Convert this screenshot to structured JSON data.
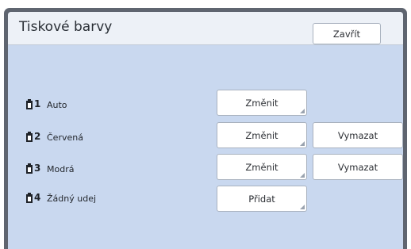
{
  "header": {
    "title": "Tiskové barvy",
    "close_label": "Zavřít"
  },
  "rows": [
    {
      "num": "1",
      "label": "Auto",
      "primary_label": "Změnit",
      "secondary_label": ""
    },
    {
      "num": "2",
      "label": "Červená",
      "primary_label": "Změnit",
      "secondary_label": "Vymazat"
    },
    {
      "num": "3",
      "label": "Modrá",
      "primary_label": "Změnit",
      "secondary_label": "Vymazat"
    },
    {
      "num": "4",
      "label": "Žádný udej",
      "primary_label": "Přidat",
      "secondary_label": ""
    }
  ],
  "icons": {
    "row": "ink-drum-icon"
  },
  "colors": {
    "frame": "#5f6570",
    "panel": "#c9d8ef",
    "header": "#edf1f7",
    "button": "#ffffff"
  }
}
